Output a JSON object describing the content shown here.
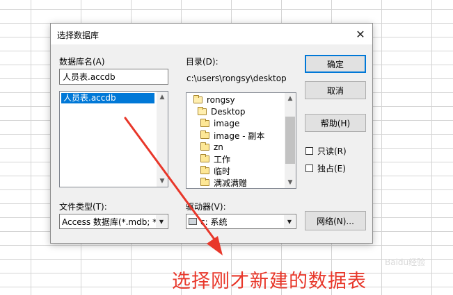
{
  "dialog": {
    "title": "选择数据库",
    "close_icon": "close-icon"
  },
  "db_name": {
    "label": "数据库名(A)",
    "value": "人员表.accdb",
    "list_items": [
      "人员表.accdb"
    ]
  },
  "directory": {
    "label": "目录(D):",
    "path": "c:\\users\\rongsy\\desktop",
    "items": [
      {
        "name": "rongsy",
        "icon": "folder-open-icon"
      },
      {
        "name": "Desktop",
        "icon": "folder-open-icon"
      },
      {
        "name": "image",
        "icon": "folder-icon"
      },
      {
        "name": "image - 副本",
        "icon": "folder-icon"
      },
      {
        "name": "zn",
        "icon": "folder-icon"
      },
      {
        "name": "工作",
        "icon": "folder-icon"
      },
      {
        "name": "临时",
        "icon": "folder-icon"
      },
      {
        "name": "满减满赠",
        "icon": "folder-icon"
      }
    ]
  },
  "buttons": {
    "ok": "确定",
    "cancel": "取消",
    "help": "帮助(H)",
    "network": "网络(N)..."
  },
  "checkboxes": {
    "readonly": "只读(R)",
    "exclusive": "独占(E)"
  },
  "file_type": {
    "label": "文件类型(T):",
    "value": "Access 数据库(*.mdb; *."
  },
  "drive": {
    "label": "驱动器(V):",
    "value": "c: 系统"
  },
  "annotation": {
    "caption": "选择刚才新建的数据表",
    "color": "#e8372a"
  },
  "watermark": "Baidu经验"
}
